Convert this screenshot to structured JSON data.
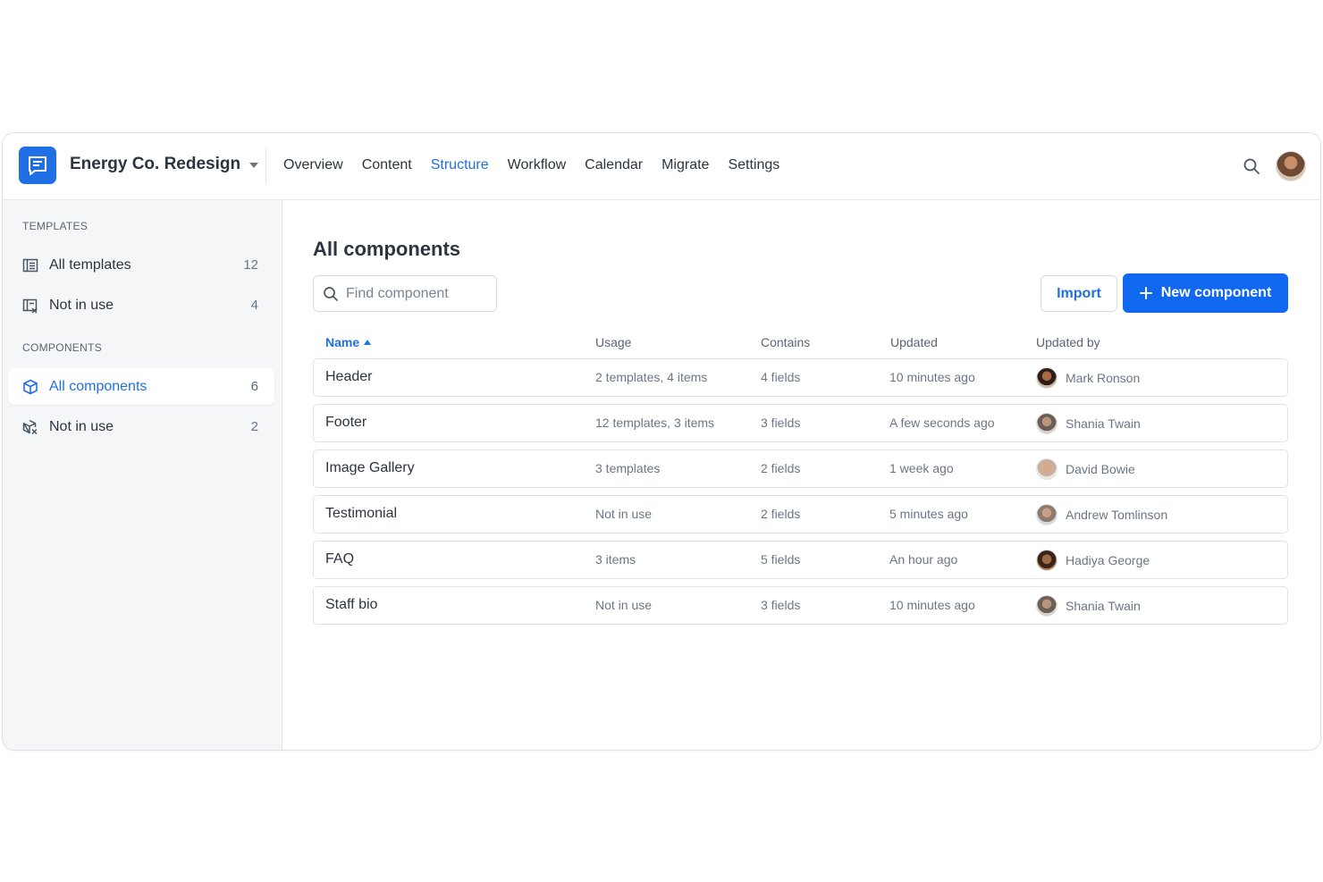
{
  "app": {
    "project_name": "Energy Co. Redesign",
    "accent_color": "#1f6fe5",
    "logo_icon": "document-chat-icon"
  },
  "nav": {
    "items": [
      {
        "label": "Overview",
        "active": false
      },
      {
        "label": "Content",
        "active": false
      },
      {
        "label": "Structure",
        "active": true
      },
      {
        "label": "Workflow",
        "active": false
      },
      {
        "label": "Calendar",
        "active": false
      },
      {
        "label": "Migrate",
        "active": false
      },
      {
        "label": "Settings",
        "active": false
      }
    ],
    "search_icon": "search-icon"
  },
  "sidebar": {
    "templates_heading": "TEMPLATES",
    "components_heading": "COMPONENTS",
    "templates": [
      {
        "label": "All templates",
        "count": "12",
        "icon": "template-list-icon"
      },
      {
        "label": "Not in use",
        "count": "4",
        "icon": "template-unused-icon"
      }
    ],
    "components": [
      {
        "label": "All components",
        "count": "6",
        "icon": "cube-icon",
        "active": true
      },
      {
        "label": "Not in use",
        "count": "2",
        "icon": "cube-unused-icon"
      }
    ]
  },
  "main": {
    "title": "All components",
    "search_placeholder": "Find component",
    "import_label": "Import",
    "new_label": "New component",
    "columns": {
      "name": "Name",
      "usage": "Usage",
      "contains": "Contains",
      "updated": "Updated",
      "updated_by": "Updated by"
    },
    "rows": [
      {
        "name": "Header",
        "usage": "2 templates, 4 items",
        "contains": "4 fields",
        "updated": "10 minutes ago",
        "by": "Mark Ronson"
      },
      {
        "name": "Footer",
        "usage": "12 templates, 3 items",
        "contains": "3 fields",
        "updated": "A few seconds ago",
        "by": "Shania Twain"
      },
      {
        "name": "Image Gallery",
        "usage": "3 templates",
        "contains": "2 fields",
        "updated": "1 week ago",
        "by": "David Bowie"
      },
      {
        "name": "Testimonial",
        "usage": "Not in use",
        "contains": "2 fields",
        "updated": "5 minutes ago",
        "by": "Andrew Tomlinson"
      },
      {
        "name": "FAQ",
        "usage": "3 items",
        "contains": "5 fields",
        "updated": "An hour ago",
        "by": "Hadiya George"
      },
      {
        "name": "Staff bio",
        "usage": "Not in use",
        "contains": "3 fields",
        "updated": "10 minutes ago",
        "by": "Shania Twain"
      }
    ]
  }
}
